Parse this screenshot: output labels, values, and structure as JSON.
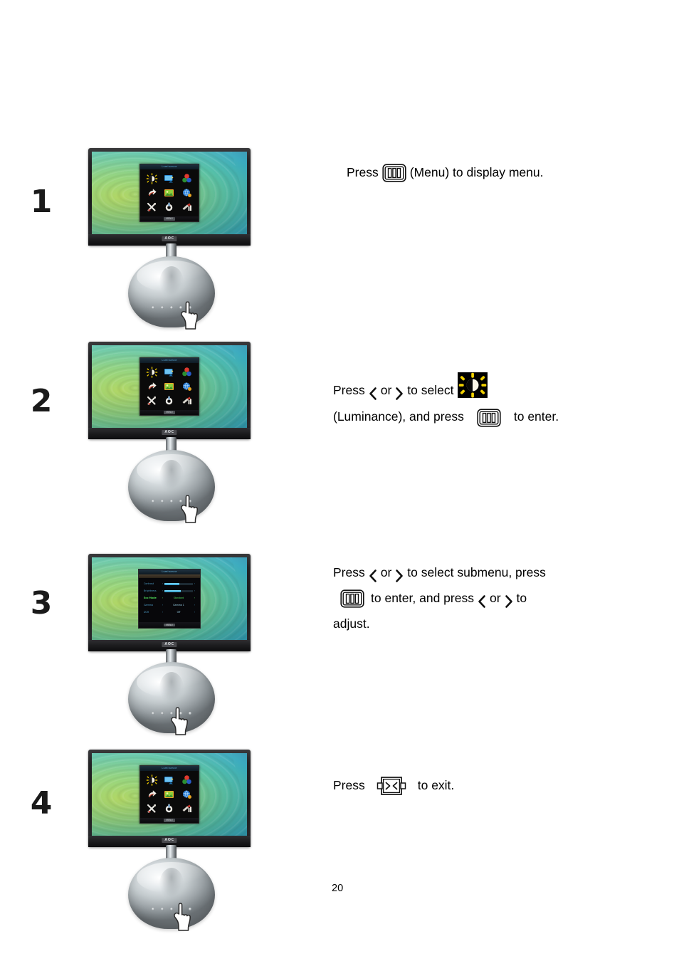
{
  "document": {
    "page_number": "20",
    "brand_logo": "AOC"
  },
  "steps": [
    {
      "number": "1",
      "monitor": {
        "osd_type": "main-menu",
        "osd_title": "Luminance",
        "osd_footer": "MENU",
        "icons": [
          "luminance-sun-icon",
          "image-setup-icon",
          "color-setup-icon",
          "picture-boost-icon",
          "osd-setup-icon",
          "extra-icon",
          "reset-icon",
          "exit-icon",
          "input-select-icon"
        ]
      },
      "text": {
        "l1_a": "Press",
        "l1_key": "menu-key",
        "l1_b": "(Menu) to display menu."
      }
    },
    {
      "number": "2",
      "monitor": {
        "osd_type": "main-menu",
        "osd_title": "Luminance",
        "osd_footer": "MENU",
        "icons": [
          "luminance-sun-icon",
          "image-setup-icon",
          "color-setup-icon",
          "picture-boost-icon",
          "osd-setup-icon",
          "extra-icon",
          "reset-icon",
          "exit-icon",
          "input-select-icon"
        ]
      },
      "text": {
        "l1_a": "Press",
        "l1_or": "or",
        "l1_b": "to select",
        "l2_a": "(Luminance), and press",
        "l2_b": "to enter."
      }
    },
    {
      "number": "3",
      "monitor": {
        "osd_type": "submenu",
        "osd_title": "Luminance",
        "osd_footer": "MENU",
        "rows": [
          {
            "label": "Contrast",
            "type": "slider",
            "fill": 52,
            "active": false
          },
          {
            "label": "Brightness",
            "type": "slider",
            "fill": 58,
            "active": false
          },
          {
            "label": "Eco Mode",
            "type": "value",
            "value": "Standard",
            "active": true
          },
          {
            "label": "Gamma",
            "type": "value",
            "value": "Gamma 1",
            "active": false
          },
          {
            "label": "DCR",
            "type": "value",
            "value": "Off",
            "active": false
          }
        ]
      },
      "text": {
        "l1_a": "Press",
        "l1_or": "or",
        "l1_b": "to select submenu, press",
        "l2_a": "to enter, and press",
        "l2_or": "or",
        "l2_b": "to",
        "l3": "adjust."
      }
    },
    {
      "number": "4",
      "monitor": {
        "osd_type": "main-menu",
        "osd_title": "Luminance",
        "osd_footer": "MENU",
        "icons": [
          "luminance-sun-icon",
          "image-setup-icon",
          "color-setup-icon",
          "picture-boost-icon",
          "osd-setup-icon",
          "extra-icon",
          "reset-icon",
          "exit-icon",
          "input-select-icon"
        ]
      },
      "text": {
        "l1_a": "Press",
        "l1_key": "exit-key",
        "l1_b": "to exit."
      }
    }
  ],
  "colors": {
    "luminance_yellow": "#f2d100",
    "eco_green": "#52e05a",
    "osd_blue": "#4f9ec9",
    "slider_cyan": "#2b9ccd"
  }
}
